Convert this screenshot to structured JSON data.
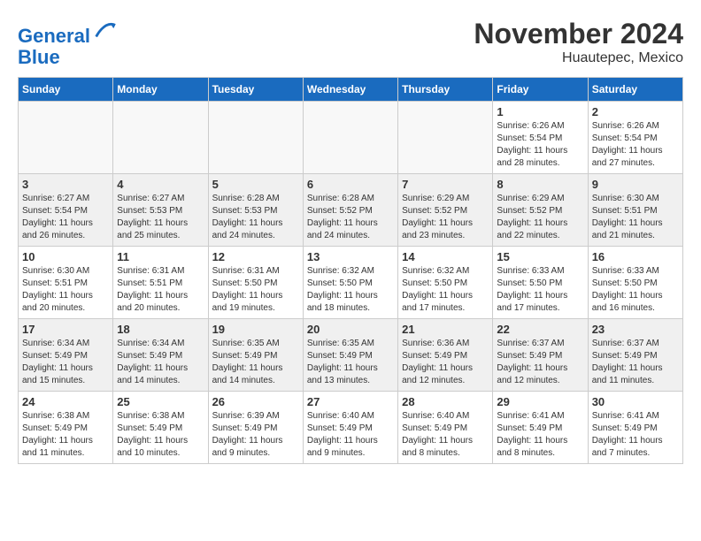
{
  "header": {
    "logo_line1": "General",
    "logo_line2": "Blue",
    "month_title": "November 2024",
    "subtitle": "Huautepec, Mexico"
  },
  "weekdays": [
    "Sunday",
    "Monday",
    "Tuesday",
    "Wednesday",
    "Thursday",
    "Friday",
    "Saturday"
  ],
  "weeks": [
    [
      {
        "day": "",
        "info": ""
      },
      {
        "day": "",
        "info": ""
      },
      {
        "day": "",
        "info": ""
      },
      {
        "day": "",
        "info": ""
      },
      {
        "day": "",
        "info": ""
      },
      {
        "day": "1",
        "info": "Sunrise: 6:26 AM\nSunset: 5:54 PM\nDaylight: 11 hours and 28 minutes."
      },
      {
        "day": "2",
        "info": "Sunrise: 6:26 AM\nSunset: 5:54 PM\nDaylight: 11 hours and 27 minutes."
      }
    ],
    [
      {
        "day": "3",
        "info": "Sunrise: 6:27 AM\nSunset: 5:54 PM\nDaylight: 11 hours and 26 minutes."
      },
      {
        "day": "4",
        "info": "Sunrise: 6:27 AM\nSunset: 5:53 PM\nDaylight: 11 hours and 25 minutes."
      },
      {
        "day": "5",
        "info": "Sunrise: 6:28 AM\nSunset: 5:53 PM\nDaylight: 11 hours and 24 minutes."
      },
      {
        "day": "6",
        "info": "Sunrise: 6:28 AM\nSunset: 5:52 PM\nDaylight: 11 hours and 24 minutes."
      },
      {
        "day": "7",
        "info": "Sunrise: 6:29 AM\nSunset: 5:52 PM\nDaylight: 11 hours and 23 minutes."
      },
      {
        "day": "8",
        "info": "Sunrise: 6:29 AM\nSunset: 5:52 PM\nDaylight: 11 hours and 22 minutes."
      },
      {
        "day": "9",
        "info": "Sunrise: 6:30 AM\nSunset: 5:51 PM\nDaylight: 11 hours and 21 minutes."
      }
    ],
    [
      {
        "day": "10",
        "info": "Sunrise: 6:30 AM\nSunset: 5:51 PM\nDaylight: 11 hours and 20 minutes."
      },
      {
        "day": "11",
        "info": "Sunrise: 6:31 AM\nSunset: 5:51 PM\nDaylight: 11 hours and 20 minutes."
      },
      {
        "day": "12",
        "info": "Sunrise: 6:31 AM\nSunset: 5:50 PM\nDaylight: 11 hours and 19 minutes."
      },
      {
        "day": "13",
        "info": "Sunrise: 6:32 AM\nSunset: 5:50 PM\nDaylight: 11 hours and 18 minutes."
      },
      {
        "day": "14",
        "info": "Sunrise: 6:32 AM\nSunset: 5:50 PM\nDaylight: 11 hours and 17 minutes."
      },
      {
        "day": "15",
        "info": "Sunrise: 6:33 AM\nSunset: 5:50 PM\nDaylight: 11 hours and 17 minutes."
      },
      {
        "day": "16",
        "info": "Sunrise: 6:33 AM\nSunset: 5:50 PM\nDaylight: 11 hours and 16 minutes."
      }
    ],
    [
      {
        "day": "17",
        "info": "Sunrise: 6:34 AM\nSunset: 5:49 PM\nDaylight: 11 hours and 15 minutes."
      },
      {
        "day": "18",
        "info": "Sunrise: 6:34 AM\nSunset: 5:49 PM\nDaylight: 11 hours and 14 minutes."
      },
      {
        "day": "19",
        "info": "Sunrise: 6:35 AM\nSunset: 5:49 PM\nDaylight: 11 hours and 14 minutes."
      },
      {
        "day": "20",
        "info": "Sunrise: 6:35 AM\nSunset: 5:49 PM\nDaylight: 11 hours and 13 minutes."
      },
      {
        "day": "21",
        "info": "Sunrise: 6:36 AM\nSunset: 5:49 PM\nDaylight: 11 hours and 12 minutes."
      },
      {
        "day": "22",
        "info": "Sunrise: 6:37 AM\nSunset: 5:49 PM\nDaylight: 11 hours and 12 minutes."
      },
      {
        "day": "23",
        "info": "Sunrise: 6:37 AM\nSunset: 5:49 PM\nDaylight: 11 hours and 11 minutes."
      }
    ],
    [
      {
        "day": "24",
        "info": "Sunrise: 6:38 AM\nSunset: 5:49 PM\nDaylight: 11 hours and 11 minutes."
      },
      {
        "day": "25",
        "info": "Sunrise: 6:38 AM\nSunset: 5:49 PM\nDaylight: 11 hours and 10 minutes."
      },
      {
        "day": "26",
        "info": "Sunrise: 6:39 AM\nSunset: 5:49 PM\nDaylight: 11 hours and 9 minutes."
      },
      {
        "day": "27",
        "info": "Sunrise: 6:40 AM\nSunset: 5:49 PM\nDaylight: 11 hours and 9 minutes."
      },
      {
        "day": "28",
        "info": "Sunrise: 6:40 AM\nSunset: 5:49 PM\nDaylight: 11 hours and 8 minutes."
      },
      {
        "day": "29",
        "info": "Sunrise: 6:41 AM\nSunset: 5:49 PM\nDaylight: 11 hours and 8 minutes."
      },
      {
        "day": "30",
        "info": "Sunrise: 6:41 AM\nSunset: 5:49 PM\nDaylight: 11 hours and 7 minutes."
      }
    ]
  ]
}
